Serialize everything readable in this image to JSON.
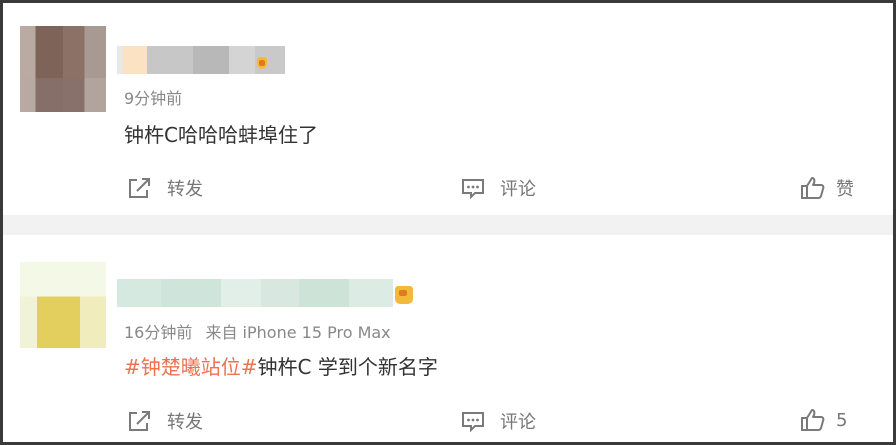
{
  "comments": [
    {
      "time": "9分钟前",
      "device": "",
      "text": "钟杵C哈哈哈蚌埠住了",
      "hashtag": "",
      "actions": {
        "repost": "转发",
        "comment": "评论",
        "like": "赞"
      }
    },
    {
      "time": "16分钟前",
      "device": "来自 iPhone 15 Pro Max",
      "hashtag": "#钟楚曦站位#",
      "text": "钟杵C 学到个新名字",
      "actions": {
        "repost": "转发",
        "comment": "评论",
        "like": "5"
      }
    }
  ],
  "colors": {
    "hashtag": "#eb7350",
    "meta": "#888888",
    "content": "#333333",
    "action": "#777777",
    "separator": "#f2f2f2"
  },
  "icons": [
    "repost-icon",
    "comment-icon",
    "like-icon",
    "vip-crown-icon"
  ]
}
